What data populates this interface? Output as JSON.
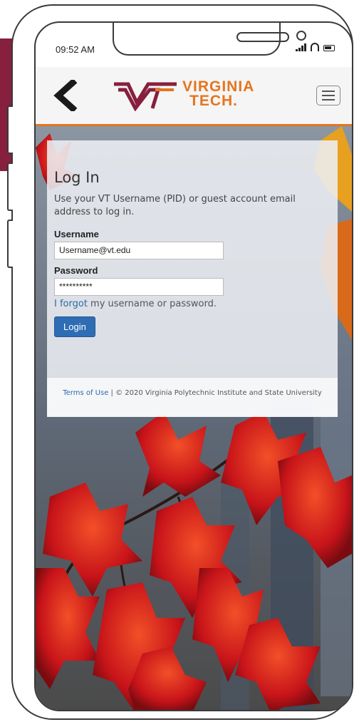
{
  "status_bar": {
    "time": "09:52 AM"
  },
  "header": {
    "logo_line1": "VIRGINIA",
    "logo_line2": "TECH.",
    "accent_color": "#e5751f",
    "brand_color": "#86203e"
  },
  "login": {
    "title": "Log In",
    "description": "Use your VT Username (PID) or guest account email address to log in.",
    "username_label": "Username",
    "username_value": "Username@vt.edu",
    "password_label": "Password",
    "password_value": "**********",
    "forgot_link": "I forgot",
    "forgot_rest": " my username or password.",
    "login_button": "Login"
  },
  "footer": {
    "terms_link": "Terms of Use",
    "separator": " | ",
    "copyright": "© 2020 Virginia Polytechnic Institute and State University"
  },
  "icons": [
    "back-chevron-icon",
    "vt-logo-icon",
    "hamburger-menu-icon",
    "signal-icon",
    "wifi-icon",
    "battery-icon"
  ]
}
